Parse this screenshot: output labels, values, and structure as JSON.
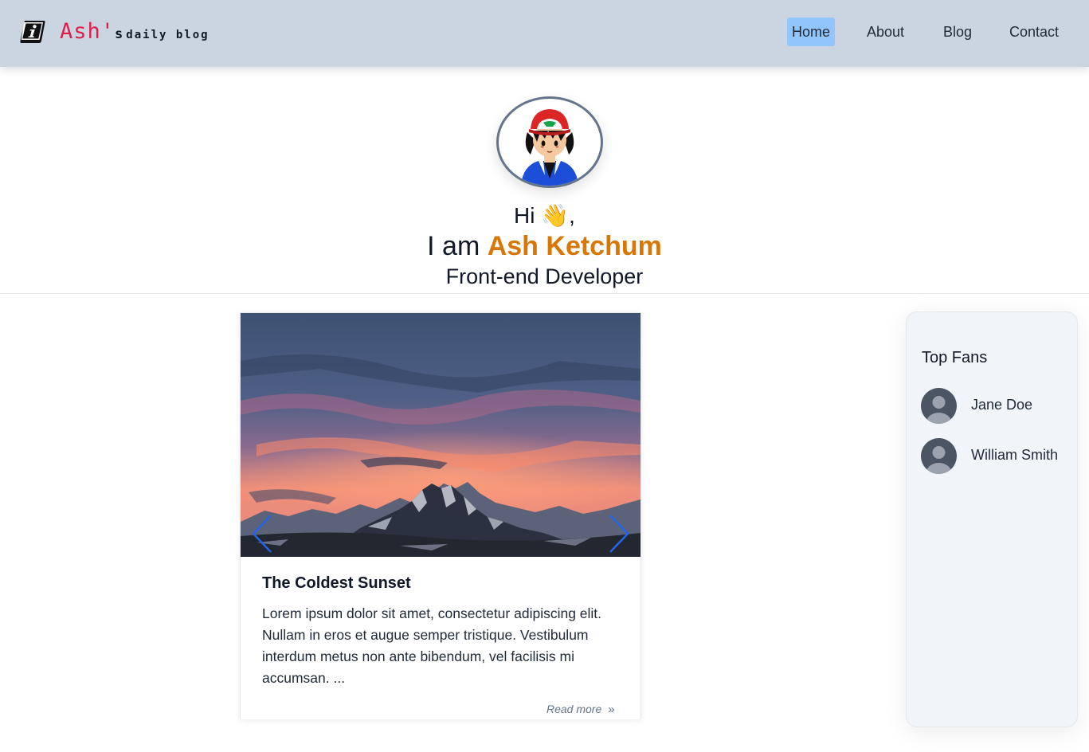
{
  "nav": {
    "logo_icon": "info-book-icon",
    "logo_name": "Ash'",
    "logo_s": "s",
    "logo_tagline": "daily blog",
    "links": [
      {
        "label": "Home",
        "active": true
      },
      {
        "label": "About",
        "active": false
      },
      {
        "label": "Blog",
        "active": false
      },
      {
        "label": "Contact",
        "active": false
      }
    ]
  },
  "hero": {
    "avatar_icon": "ash-ketchum-avatar",
    "greeting": "Hi ",
    "wave_emoji": "👋",
    "greeting_suffix": ",",
    "intro": "I am ",
    "name": "Ash Ketchum",
    "role": "Front-end Developer"
  },
  "post": {
    "image": "mountain-sunset-image",
    "prev_icon": "chevron-left-icon",
    "next_icon": "chevron-right-icon",
    "title": "The Coldest Sunset",
    "excerpt": "Lorem ipsum dolor sit amet, consectetur adipiscing elit. Nullam in eros et augue semper tristique. Vestibulum interdum metus non ante bibendum, vel facilisis mi accumsan. ...",
    "read_more": "Read more",
    "read_more_icon": "»"
  },
  "sidebar": {
    "title": "Top Fans",
    "fans": [
      {
        "name": "Jane Doe",
        "icon": "user-avatar-icon"
      },
      {
        "name": "William Smith",
        "icon": "user-avatar-icon"
      }
    ]
  },
  "colors": {
    "navbar_bg": "#cbd5e1",
    "active_link_bg": "#93c5fd",
    "logo_accent": "#e11d48",
    "name_highlight": "#d97706",
    "arrow": "#2563eb",
    "sidebar_bg": "#f1f5f9"
  }
}
